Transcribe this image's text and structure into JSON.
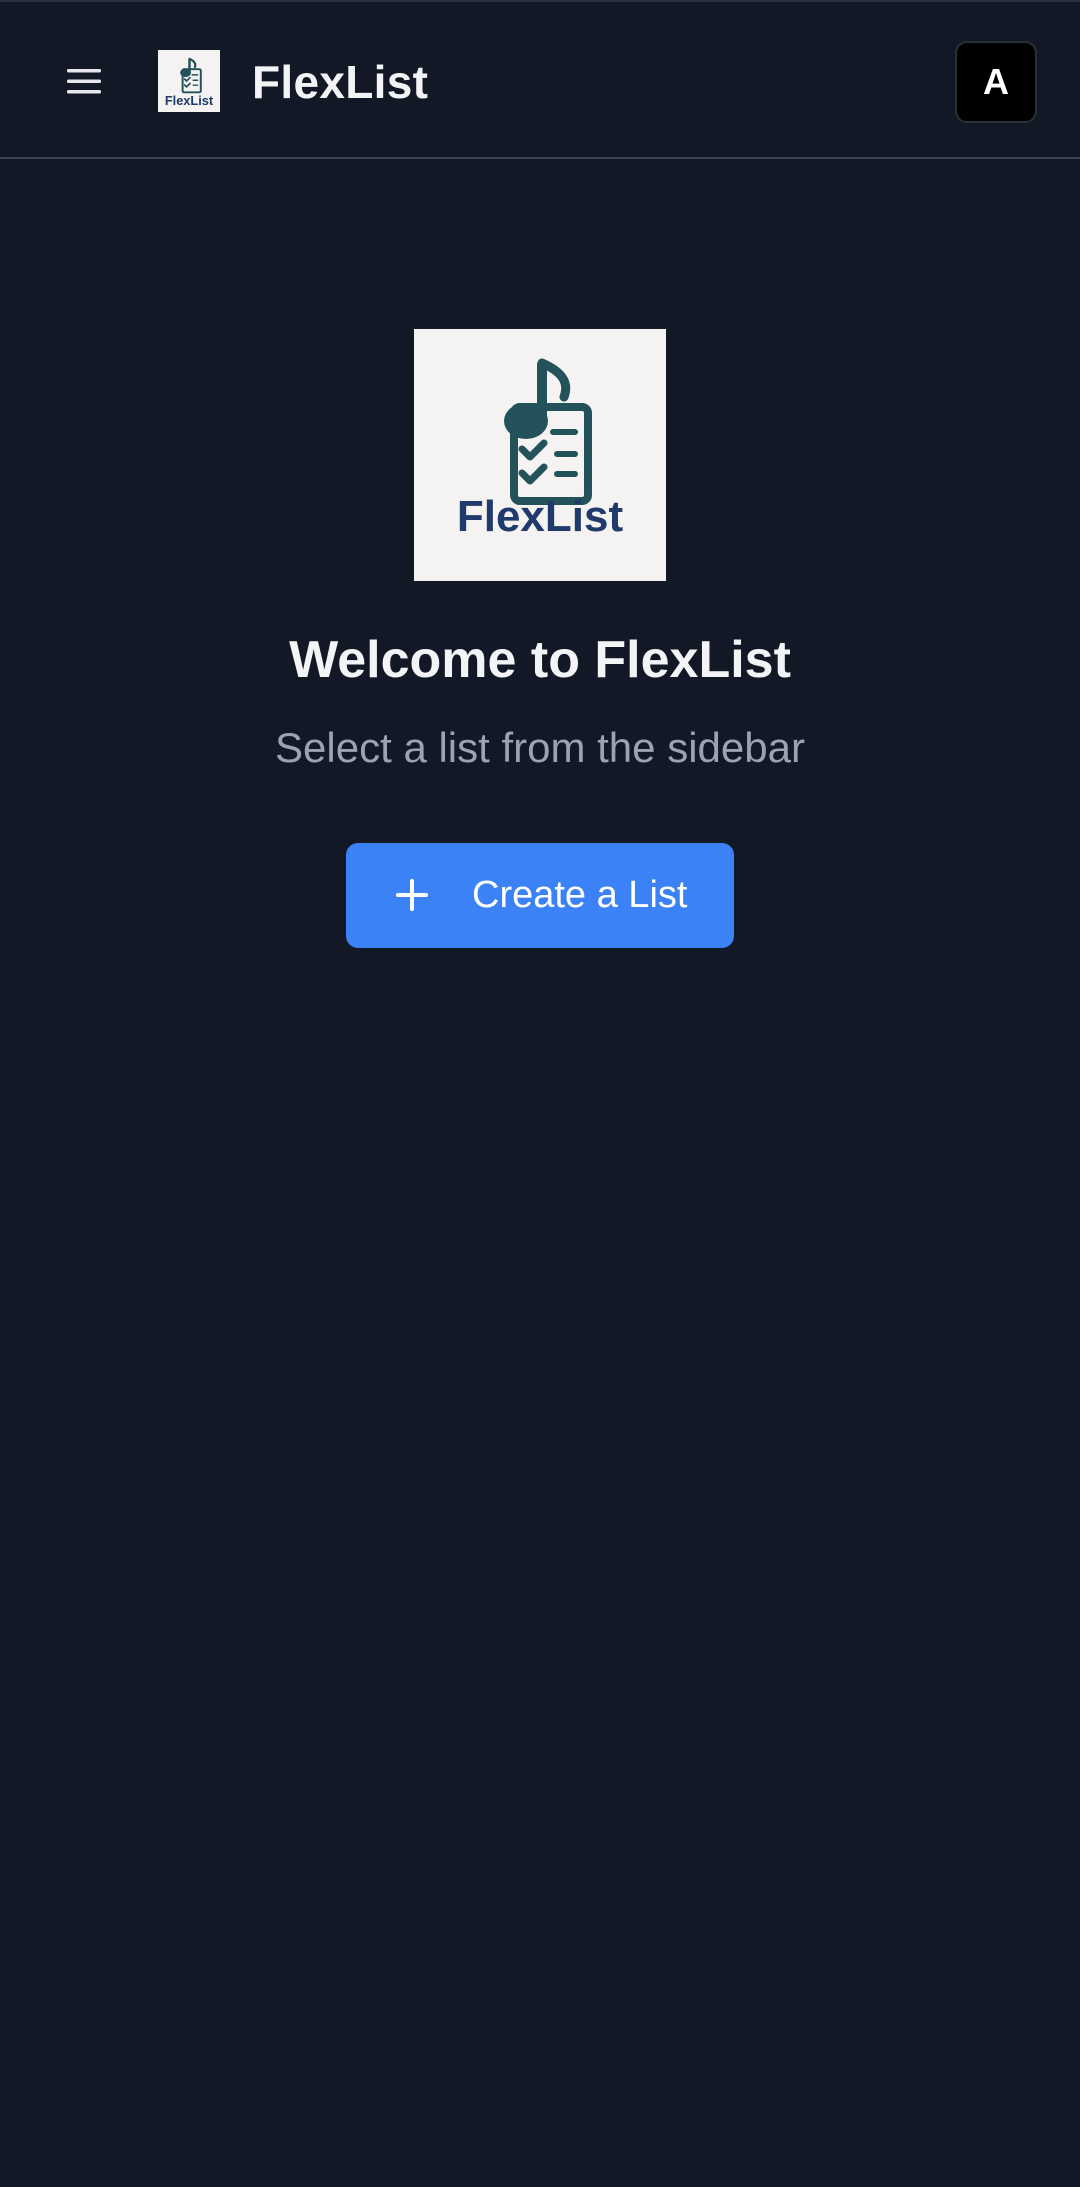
{
  "header": {
    "app_title": "FlexList",
    "avatar_initial": "A",
    "logo_small_text": "FlexList"
  },
  "main": {
    "logo_text": "FlexList",
    "welcome_title": "Welcome to FlexList",
    "welcome_subtitle": "Select a list from the sidebar",
    "create_button_label": "Create a List"
  },
  "icons": {
    "menu": "hamburger-menu-icon",
    "plus": "plus-icon",
    "logo": "music-note-checklist-icon"
  },
  "colors": {
    "background": "#121826",
    "primary_button": "#3b82f6",
    "logo_teal": "#24525a",
    "logo_navy": "#1f3a6b",
    "logo_bg": "#f5f3f1",
    "subtitle_text": "#9aa3b2"
  }
}
